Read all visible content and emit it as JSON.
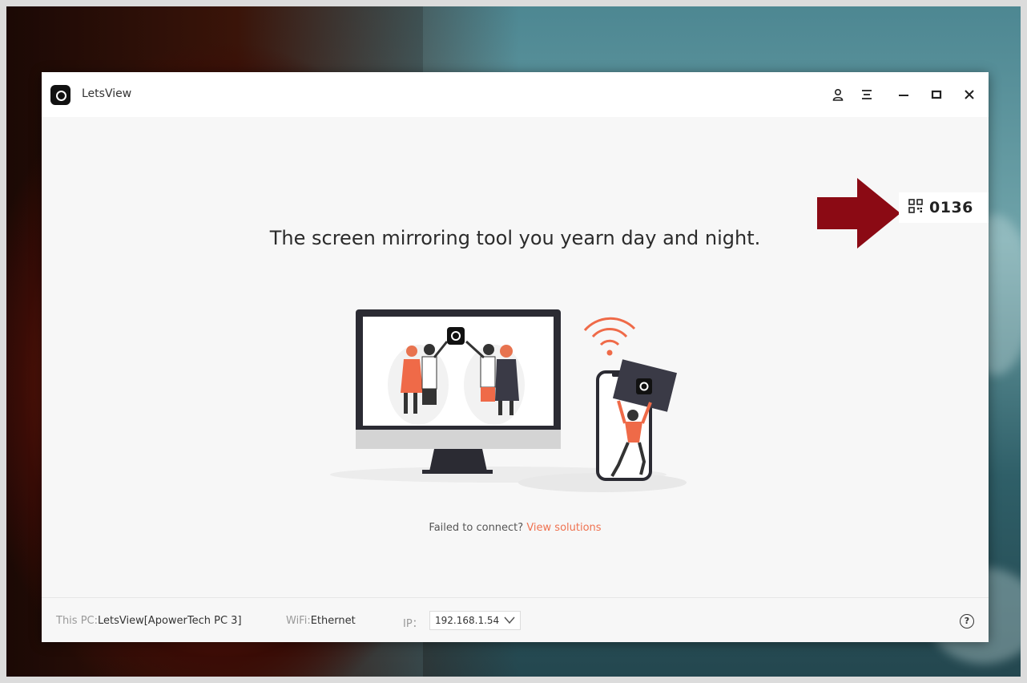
{
  "window": {
    "title": "LetsView",
    "controls": {
      "account": "account-icon",
      "menu": "menu-icon",
      "minimize": "minimize-icon",
      "maximize": "maximize-icon",
      "close": "close-icon"
    }
  },
  "room_code": {
    "icon": "qr-code-icon",
    "value": "0136"
  },
  "main": {
    "headline": "The screen mirroring tool you yearn day and night.",
    "failed_text": "Failed to connect?",
    "solutions_link": "View solutions"
  },
  "footer": {
    "pc_label": "This PC:",
    "pc_value": "LetsView[ApowerTech PC 3]",
    "wifi_label": "WiFi:",
    "wifi_value": "Ethernet",
    "ip_label": "IP：",
    "ip_value": "192.168.1.54"
  },
  "colors": {
    "accent": "#ef7250",
    "arrow": "#8b0a14",
    "window_bg": "#f7f7f7"
  }
}
